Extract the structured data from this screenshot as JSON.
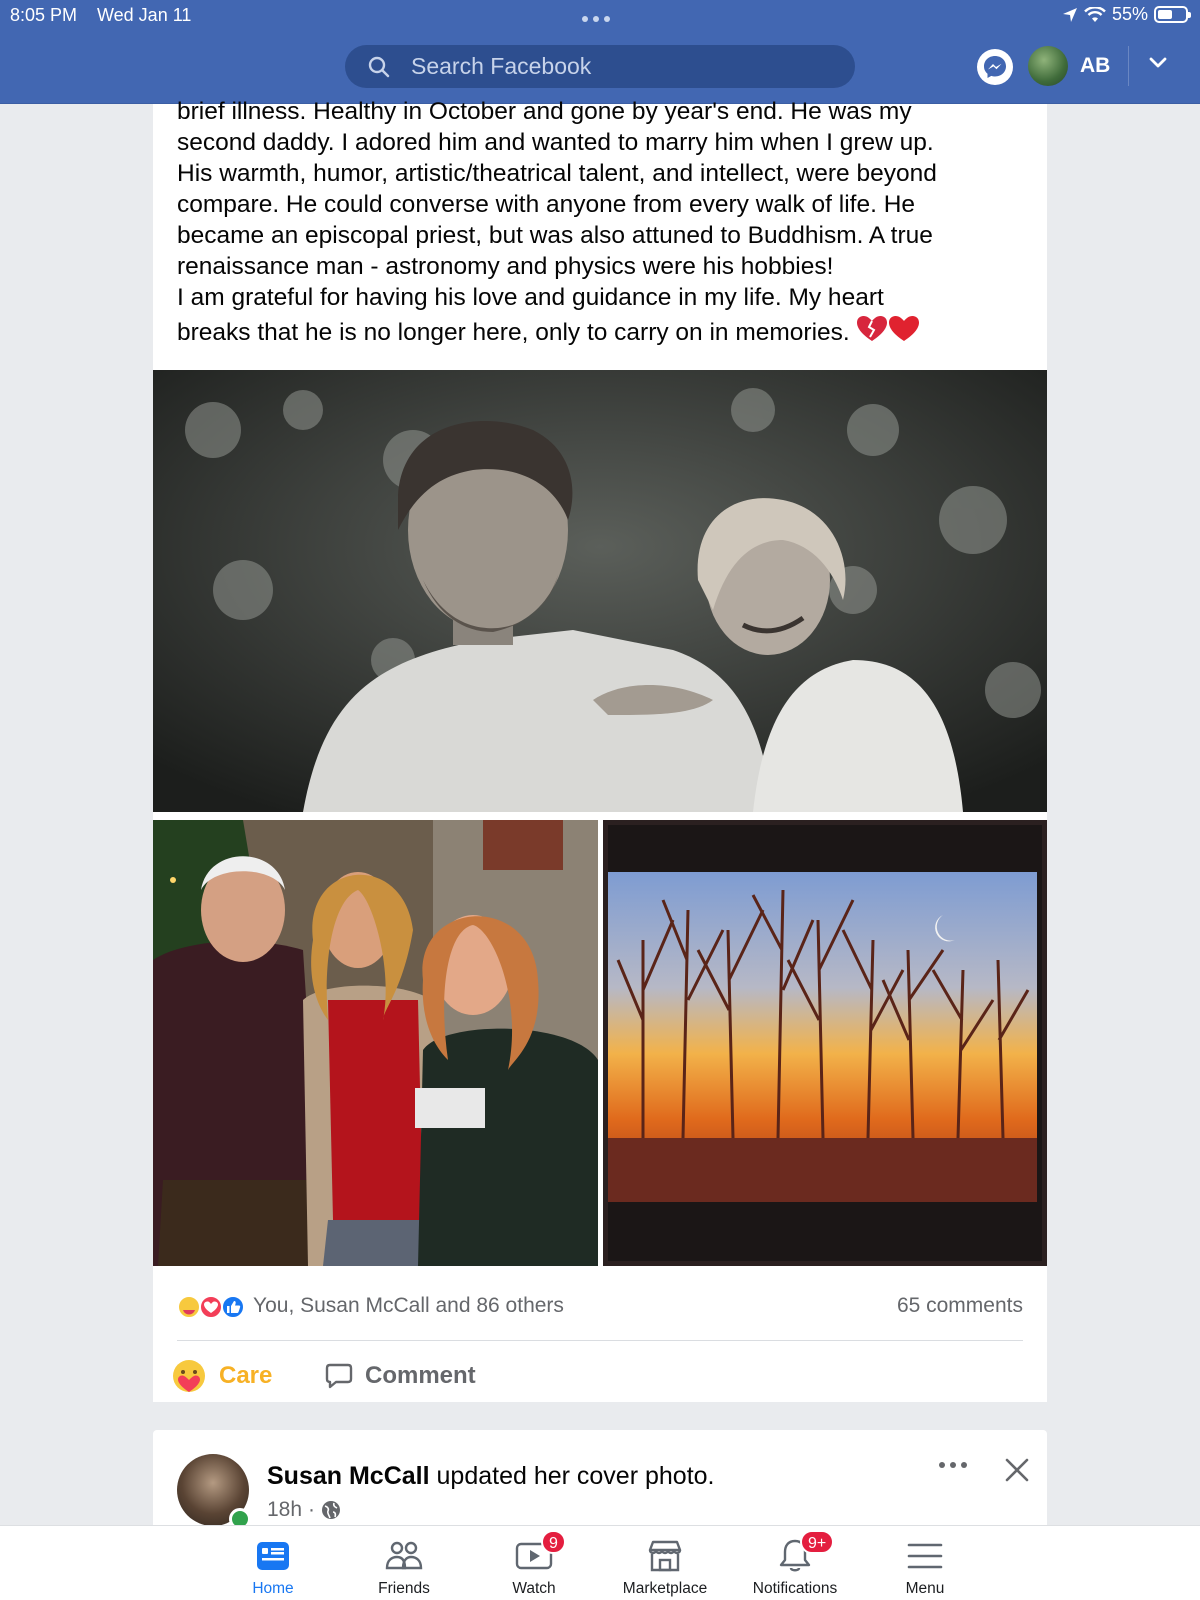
{
  "status_bar": {
    "time": "8:05 PM",
    "date": "Wed Jan 11",
    "battery": "55%",
    "battery_level": 0.55
  },
  "header": {
    "search_placeholder": "Search Facebook",
    "profile_initials": "AB"
  },
  "post": {
    "text_lines": [
      "brief illness. Healthy in October and gone by year's end. He was my",
      "second daddy. I adored him and wanted to marry him when I grew up.",
      "His warmth, humor, artistic/theatrical talent, and intellect, were beyond",
      "compare. He could converse with anyone from every walk of life. He",
      "became an episcopal priest, but was also attuned to Buddhism. A true",
      "renaissance man - astronomy and physics were his hobbies!",
      "I am grateful for having his love and guidance in my life. My heart",
      "breaks that he is no longer here, only to carry on in memories."
    ],
    "reactions_text": "You, Susan McCall and 86 others",
    "comments_count": "65 comments",
    "care_label": "Care",
    "comment_label": "Comment"
  },
  "next_post": {
    "author": "Susan McCall",
    "action": " updated her cover photo.",
    "time": "18h",
    "privacy_separator": "·"
  },
  "bottom_nav": [
    {
      "label": "Home",
      "icon": "home-icon",
      "active": true,
      "badge": ""
    },
    {
      "label": "Friends",
      "icon": "friends-icon",
      "active": false,
      "badge": ""
    },
    {
      "label": "Watch",
      "icon": "watch-icon",
      "active": false,
      "badge": "9"
    },
    {
      "label": "Marketplace",
      "icon": "marketplace-icon",
      "active": false,
      "badge": ""
    },
    {
      "label": "Notifications",
      "icon": "bell-icon",
      "active": false,
      "badge": "9+"
    },
    {
      "label": "Menu",
      "icon": "menu-icon",
      "active": false,
      "badge": ""
    }
  ],
  "colors": {
    "brand": "#4267b2",
    "active": "#1877f2",
    "care": "#f7b125",
    "badge": "#e41e3f"
  }
}
